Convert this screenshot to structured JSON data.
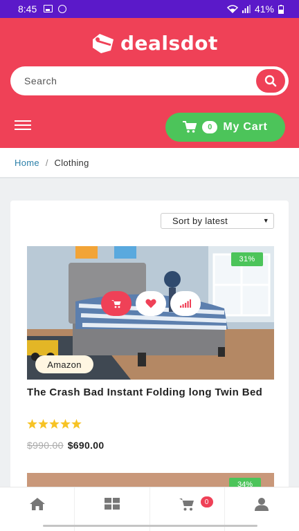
{
  "status_bar": {
    "time": "8:45",
    "battery": "41%"
  },
  "header": {
    "brand": "dealsdot",
    "search": {
      "placeholder": "Search"
    },
    "cart": {
      "label": "My Cart",
      "count": "0"
    }
  },
  "breadcrumb": {
    "home": "Home",
    "separator": "/",
    "current": "Clothing"
  },
  "listing": {
    "sort": {
      "selected": "Sort by latest"
    },
    "products": [
      {
        "title": "The Crash Bad Instant Folding long Twin Bed",
        "discount": "31%",
        "store": "Amazon",
        "rating": 5,
        "old_price": "$990.00",
        "price": "$690.00"
      },
      {
        "discount": "34%"
      }
    ]
  },
  "bottom_nav": {
    "items": [
      "home-icon",
      "grid-icon",
      "cart-icon",
      "user-icon"
    ],
    "cart_badge": "0"
  },
  "colors": {
    "brand": "#ef4157",
    "accent_green": "#4cc45a",
    "status_bar": "#5b19c9",
    "star": "#f7c325"
  }
}
